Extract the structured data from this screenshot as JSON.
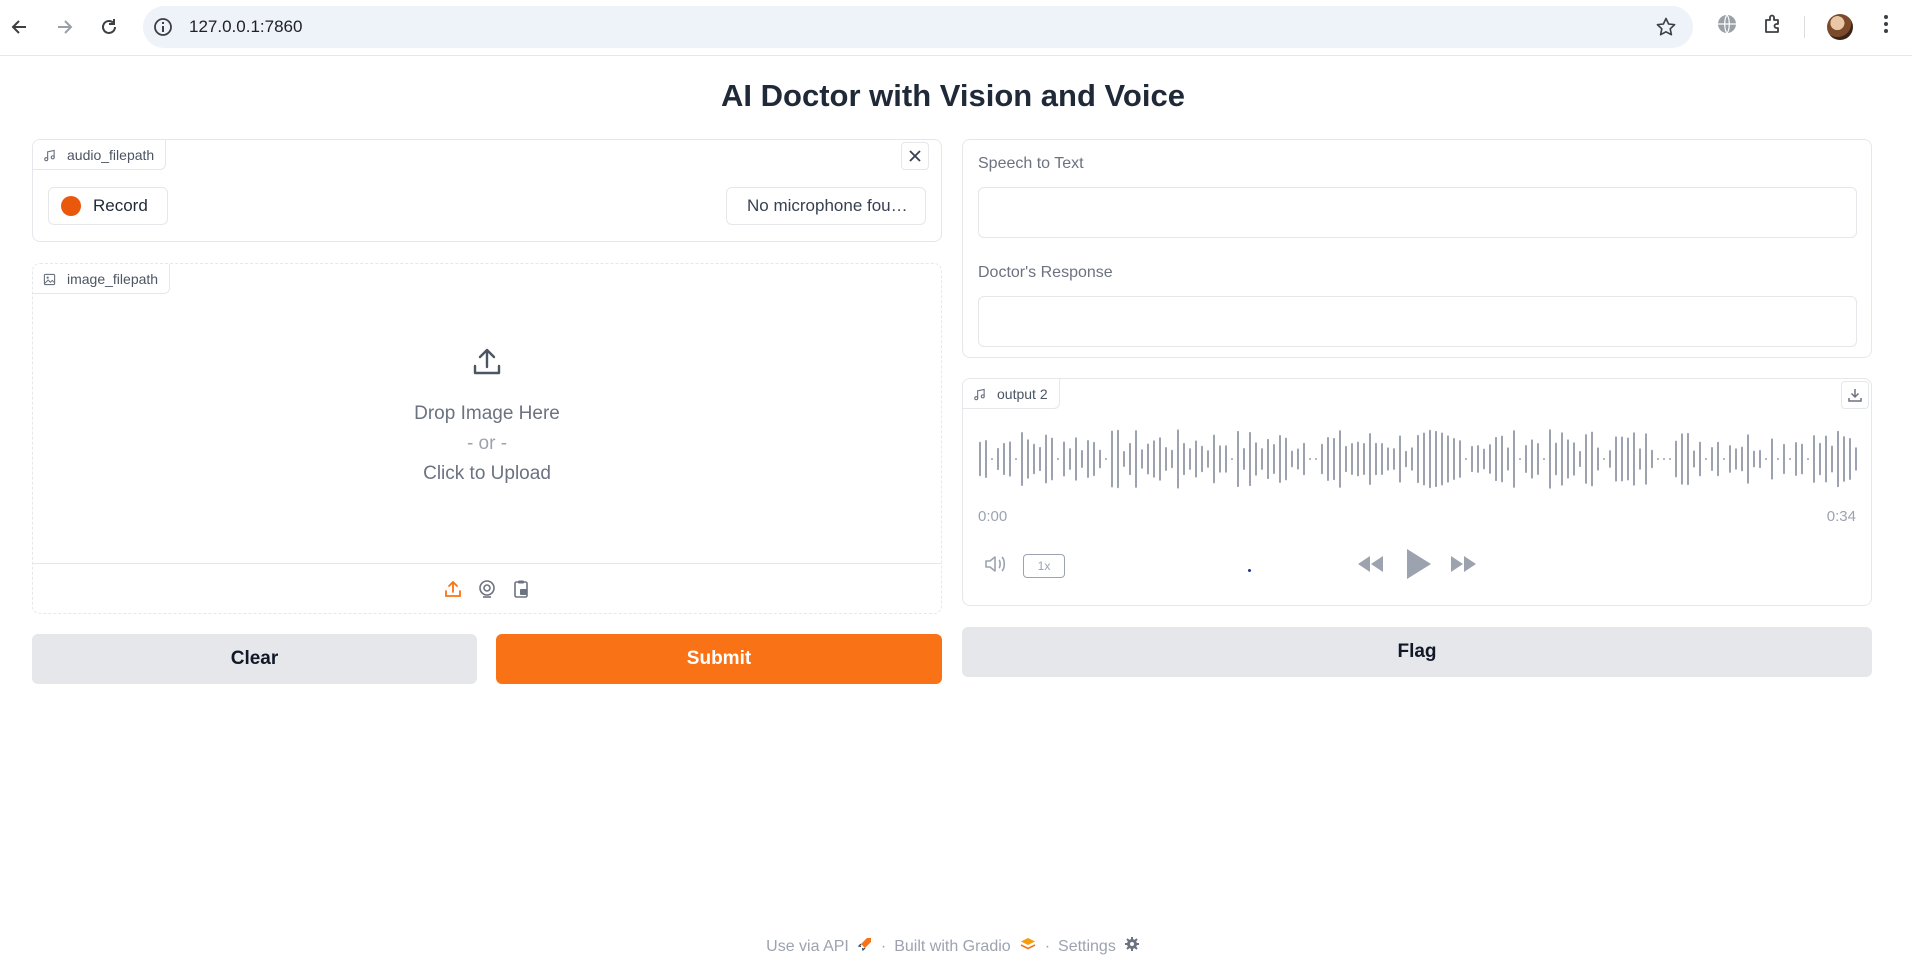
{
  "browser": {
    "url": "127.0.0.1:7860"
  },
  "page": {
    "title": "AI Doctor with Vision and Voice"
  },
  "audio_input": {
    "label": "audio_filepath",
    "record_label": "Record",
    "microphone_select": "No microphone fou…"
  },
  "image_input": {
    "label": "image_filepath",
    "drop_text": "Drop Image Here",
    "or_text": "- or -",
    "click_text": "Click to Upload"
  },
  "actions": {
    "clear_label": "Clear",
    "submit_label": "Submit",
    "flag_label": "Flag"
  },
  "outputs": {
    "speech_label": "Speech to Text",
    "speech_value": "",
    "response_label": "Doctor's Response",
    "response_value": ""
  },
  "audio_output": {
    "label": "output 2",
    "current_time": "0:00",
    "duration": "0:34",
    "playback_rate": "1x"
  },
  "footer": {
    "api_label": "Use via API",
    "built_label": "Built with Gradio",
    "settings_label": "Settings"
  },
  "colors": {
    "accent": "#f97316",
    "record_dot": "#ea580c",
    "secondary_button": "#e5e7eb"
  }
}
